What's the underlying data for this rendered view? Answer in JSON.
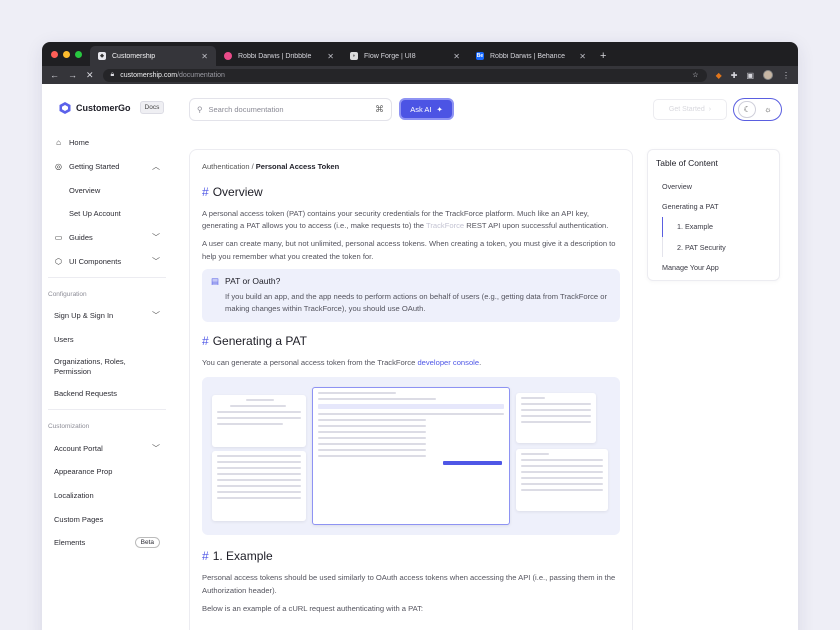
{
  "browser": {
    "tabs": [
      {
        "title": "Customership",
        "active": true,
        "color": "#e8e8ee"
      },
      {
        "title": "Robbi Darwis | Dribbble",
        "active": false,
        "color": "#ea4c89"
      },
      {
        "title": "Flow Forge | UI8",
        "active": false,
        "color": "#dddddd"
      },
      {
        "title": "Robbi Darwis | Behance",
        "active": false,
        "color": "#1769ff",
        "glyph": "Be"
      }
    ],
    "url_host": "customership.com",
    "url_path": "/documentation"
  },
  "header": {
    "brand": "CustomerGo",
    "docs_badge": "Docs",
    "search_placeholder": "Search documentation",
    "search_shortcut": "⌘",
    "ask_ai": "Ask AI",
    "get_started": "Get Started"
  },
  "sidebar": {
    "items": [
      {
        "label": "Home",
        "icon": "home-icon"
      },
      {
        "label": "Getting Started",
        "icon": "check-circle-icon"
      },
      {
        "label": "Overview"
      },
      {
        "label": "Set Up Account"
      },
      {
        "label": "Guides",
        "icon": "book-icon"
      },
      {
        "label": "UI Components",
        "icon": "box-icon"
      }
    ],
    "config_label": "Configuration",
    "config_items": [
      "Sign Up & Sign In",
      "Users",
      "Organizations, Roles, Permission",
      "Backend Requests"
    ],
    "custom_label": "Customization",
    "custom_items": [
      "Account Portal",
      "Appearance Prop",
      "Localization",
      "Custom Pages",
      "Elements"
    ],
    "beta": "Beta"
  },
  "content": {
    "breadcrumb_parent": "Authentication /",
    "breadcrumb_current": "Personal Access Token",
    "h_overview": "Overview",
    "p1_a": "A personal access token (PAT) contains your security credentials for the TrackForce platform. Much like an API key, generating a PAT allows you to access (i.e., make requests to) the",
    "p1_link": "TrackForce",
    "p1_b": "REST API upon successful authentication.",
    "p2": "A user can create many, but not unlimited, personal access tokens. When creating a token, you must give it a description to help you remember what you created the token for.",
    "callout_title": "PAT or Oauth?",
    "callout_text": "If you build an app, and the app needs to perform actions on behalf of users (e.g., getting data from TrackForce or making changes within TrackForce), you should use OAuth.",
    "h_generating": "Generating a PAT",
    "p3_a": "You can generate a personal access token from the TrackForce",
    "p3_link": "developer console",
    "p3_b": ".",
    "h_example": "1. Example",
    "p4": "Personal access tokens should be used similarly to OAuth access tokens when accessing the API (i.e., passing them in the Authorization header).",
    "p5": "Below is an example of a cURL request authenticating with a PAT:"
  },
  "toc": {
    "title": "Table of Content",
    "items": [
      "Overview",
      "Generating a PAT",
      "1. Example",
      "2. PAT Security",
      "Manage Your App"
    ]
  },
  "colors": {
    "accent": "#4f57e6",
    "tab_bg": "#1f1f22"
  }
}
